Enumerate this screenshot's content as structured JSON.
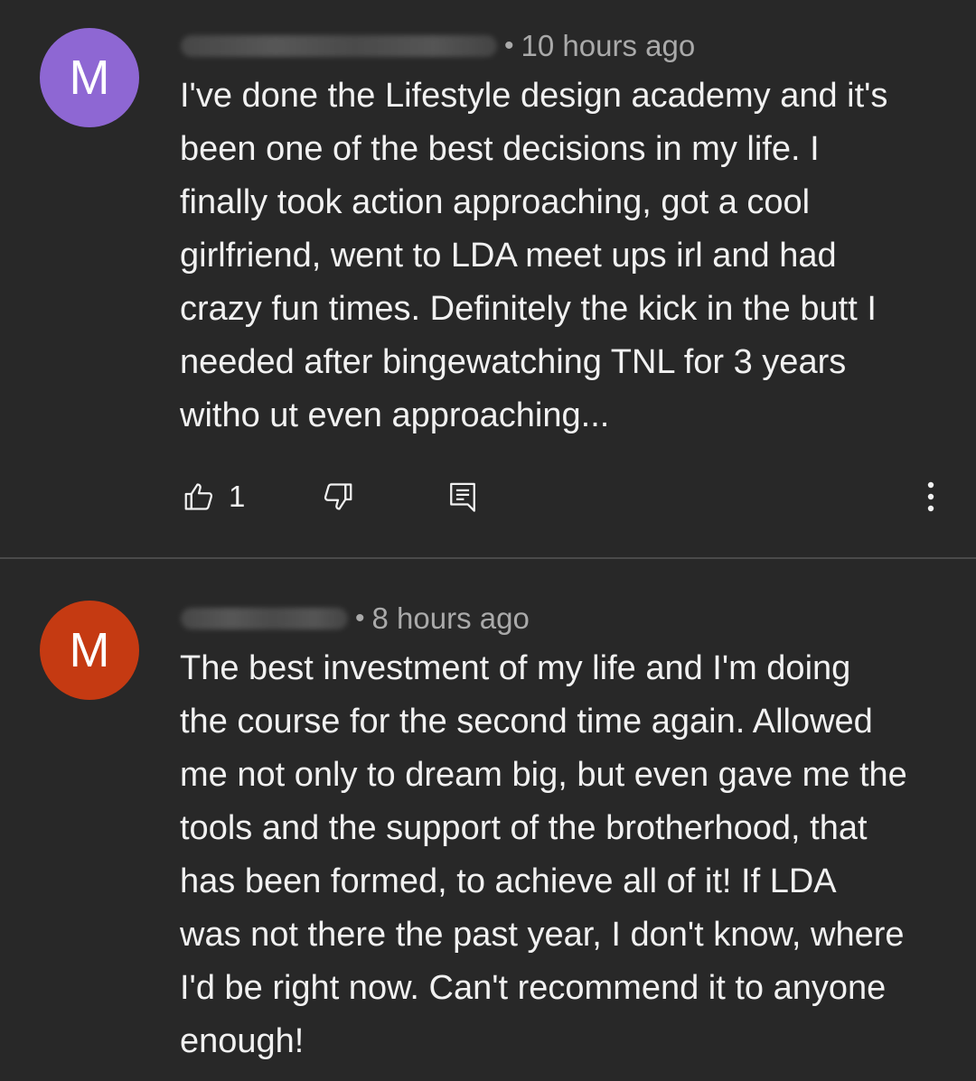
{
  "comments": [
    {
      "avatar_letter": "M",
      "avatar_color": "#8E67D3",
      "time": "10 hours ago",
      "text": "I've done the Lifestyle design academy and it's\nbeen one of the best decisions in my life. I\nfinally took action approaching, got a cool\ngirlfriend, went to LDA meet ups irl and had\ncrazy fun times. Definitely the kick in the butt I\nneeded after bingewatching TNL for 3 years\nwitho ut even approaching...",
      "like_count": "1"
    },
    {
      "avatar_letter": "M",
      "avatar_color": "#C53A12",
      "time": "8 hours ago",
      "text": "The best investment of my life and I'm doing\nthe course for the second time again. Allowed\nme not only to dream big, but even gave me the\ntools and the support of the brotherhood, that\nhas been formed, to achieve all of it! If LDA\nwas not there the past year, I don't know, where\nI'd be right now. Can't recommend it to anyone\nenough!"
    }
  ],
  "icons": {
    "like": "thumbs-up-icon",
    "dislike": "thumbs-down-icon",
    "reply": "reply-icon",
    "more": "more-vertical-icon"
  }
}
